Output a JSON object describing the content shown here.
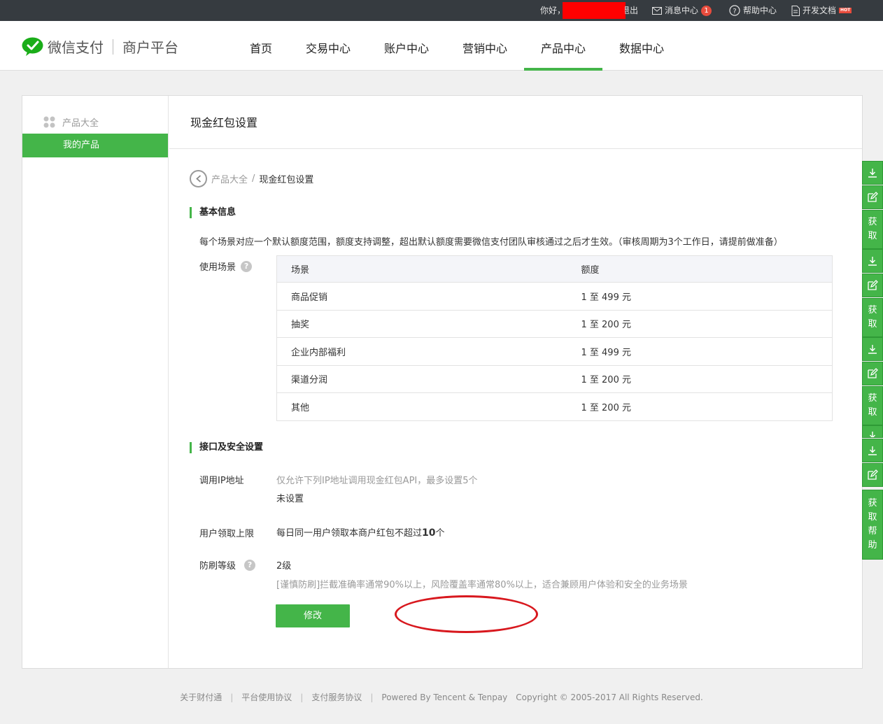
{
  "topbar": {
    "greeting": "你好，",
    "logout_fragment": "退出",
    "messages": "消息中心",
    "message_count": "1",
    "help": "帮助中心",
    "docs": "开发文档",
    "hot_badge": "HOT"
  },
  "header": {
    "brand": "微信支付",
    "platform": "商户平台",
    "nav": [
      "首页",
      "交易中心",
      "账户中心",
      "营销中心",
      "产品中心",
      "数据中心"
    ],
    "active_nav": "产品中心"
  },
  "sidebar": {
    "all_products": "产品大全",
    "my_products": "我的产品"
  },
  "main": {
    "title": "现金红包设置",
    "breadcrumb": {
      "parent": "产品大全",
      "separator": "/",
      "current": "现金红包设置"
    },
    "basic": {
      "section_title": "基本信息",
      "description": "每个场景对应一个默认额度范围，额度支持调整，超出默认额度需要微信支付团队审核通过之后才生效。（审核周期为3个工作日，请提前做准备）",
      "scene_label": "使用场景",
      "table": {
        "headers": [
          "场景",
          "额度"
        ],
        "rows": [
          [
            "商品促销",
            "1 至 499 元"
          ],
          [
            "抽奖",
            "1 至 200 元"
          ],
          [
            "企业内部福利",
            "1 至 499 元"
          ],
          [
            "渠道分润",
            "1 至 200 元"
          ],
          [
            "其他",
            "1 至 200 元"
          ]
        ]
      }
    },
    "security": {
      "section_title": "接口及安全设置",
      "ip_label": "调用IP地址",
      "ip_hint": "仅允许下列IP地址调用现金红包API，最多设置5个",
      "ip_value": "未设置",
      "limit_label": "用户领取上限",
      "limit_text_prefix": "每日同一用户领取本商户红包不超过",
      "limit_number": "10",
      "limit_text_suffix": "个",
      "level_label": "防刷等级",
      "level_value": "2级",
      "level_desc": "[谨慎防刷]拦截准确率通常90%以上，风险覆盖率通常80%以上，适合兼顾用户体验和安全的业务场景",
      "modify_button": "修改"
    }
  },
  "right_tabs": {
    "get": "获取",
    "get_help": "获取帮助"
  },
  "footer": {
    "links": [
      "关于财付通",
      "平台使用协议",
      "支付服务协议"
    ],
    "powered": "Powered By Tencent & Tenpay",
    "copyright": "Copyright © 2005-2017 All Rights Reserved."
  },
  "colors": {
    "accent": "#44b549",
    "topbar": "#363b40",
    "annotation": "#d8181e"
  }
}
